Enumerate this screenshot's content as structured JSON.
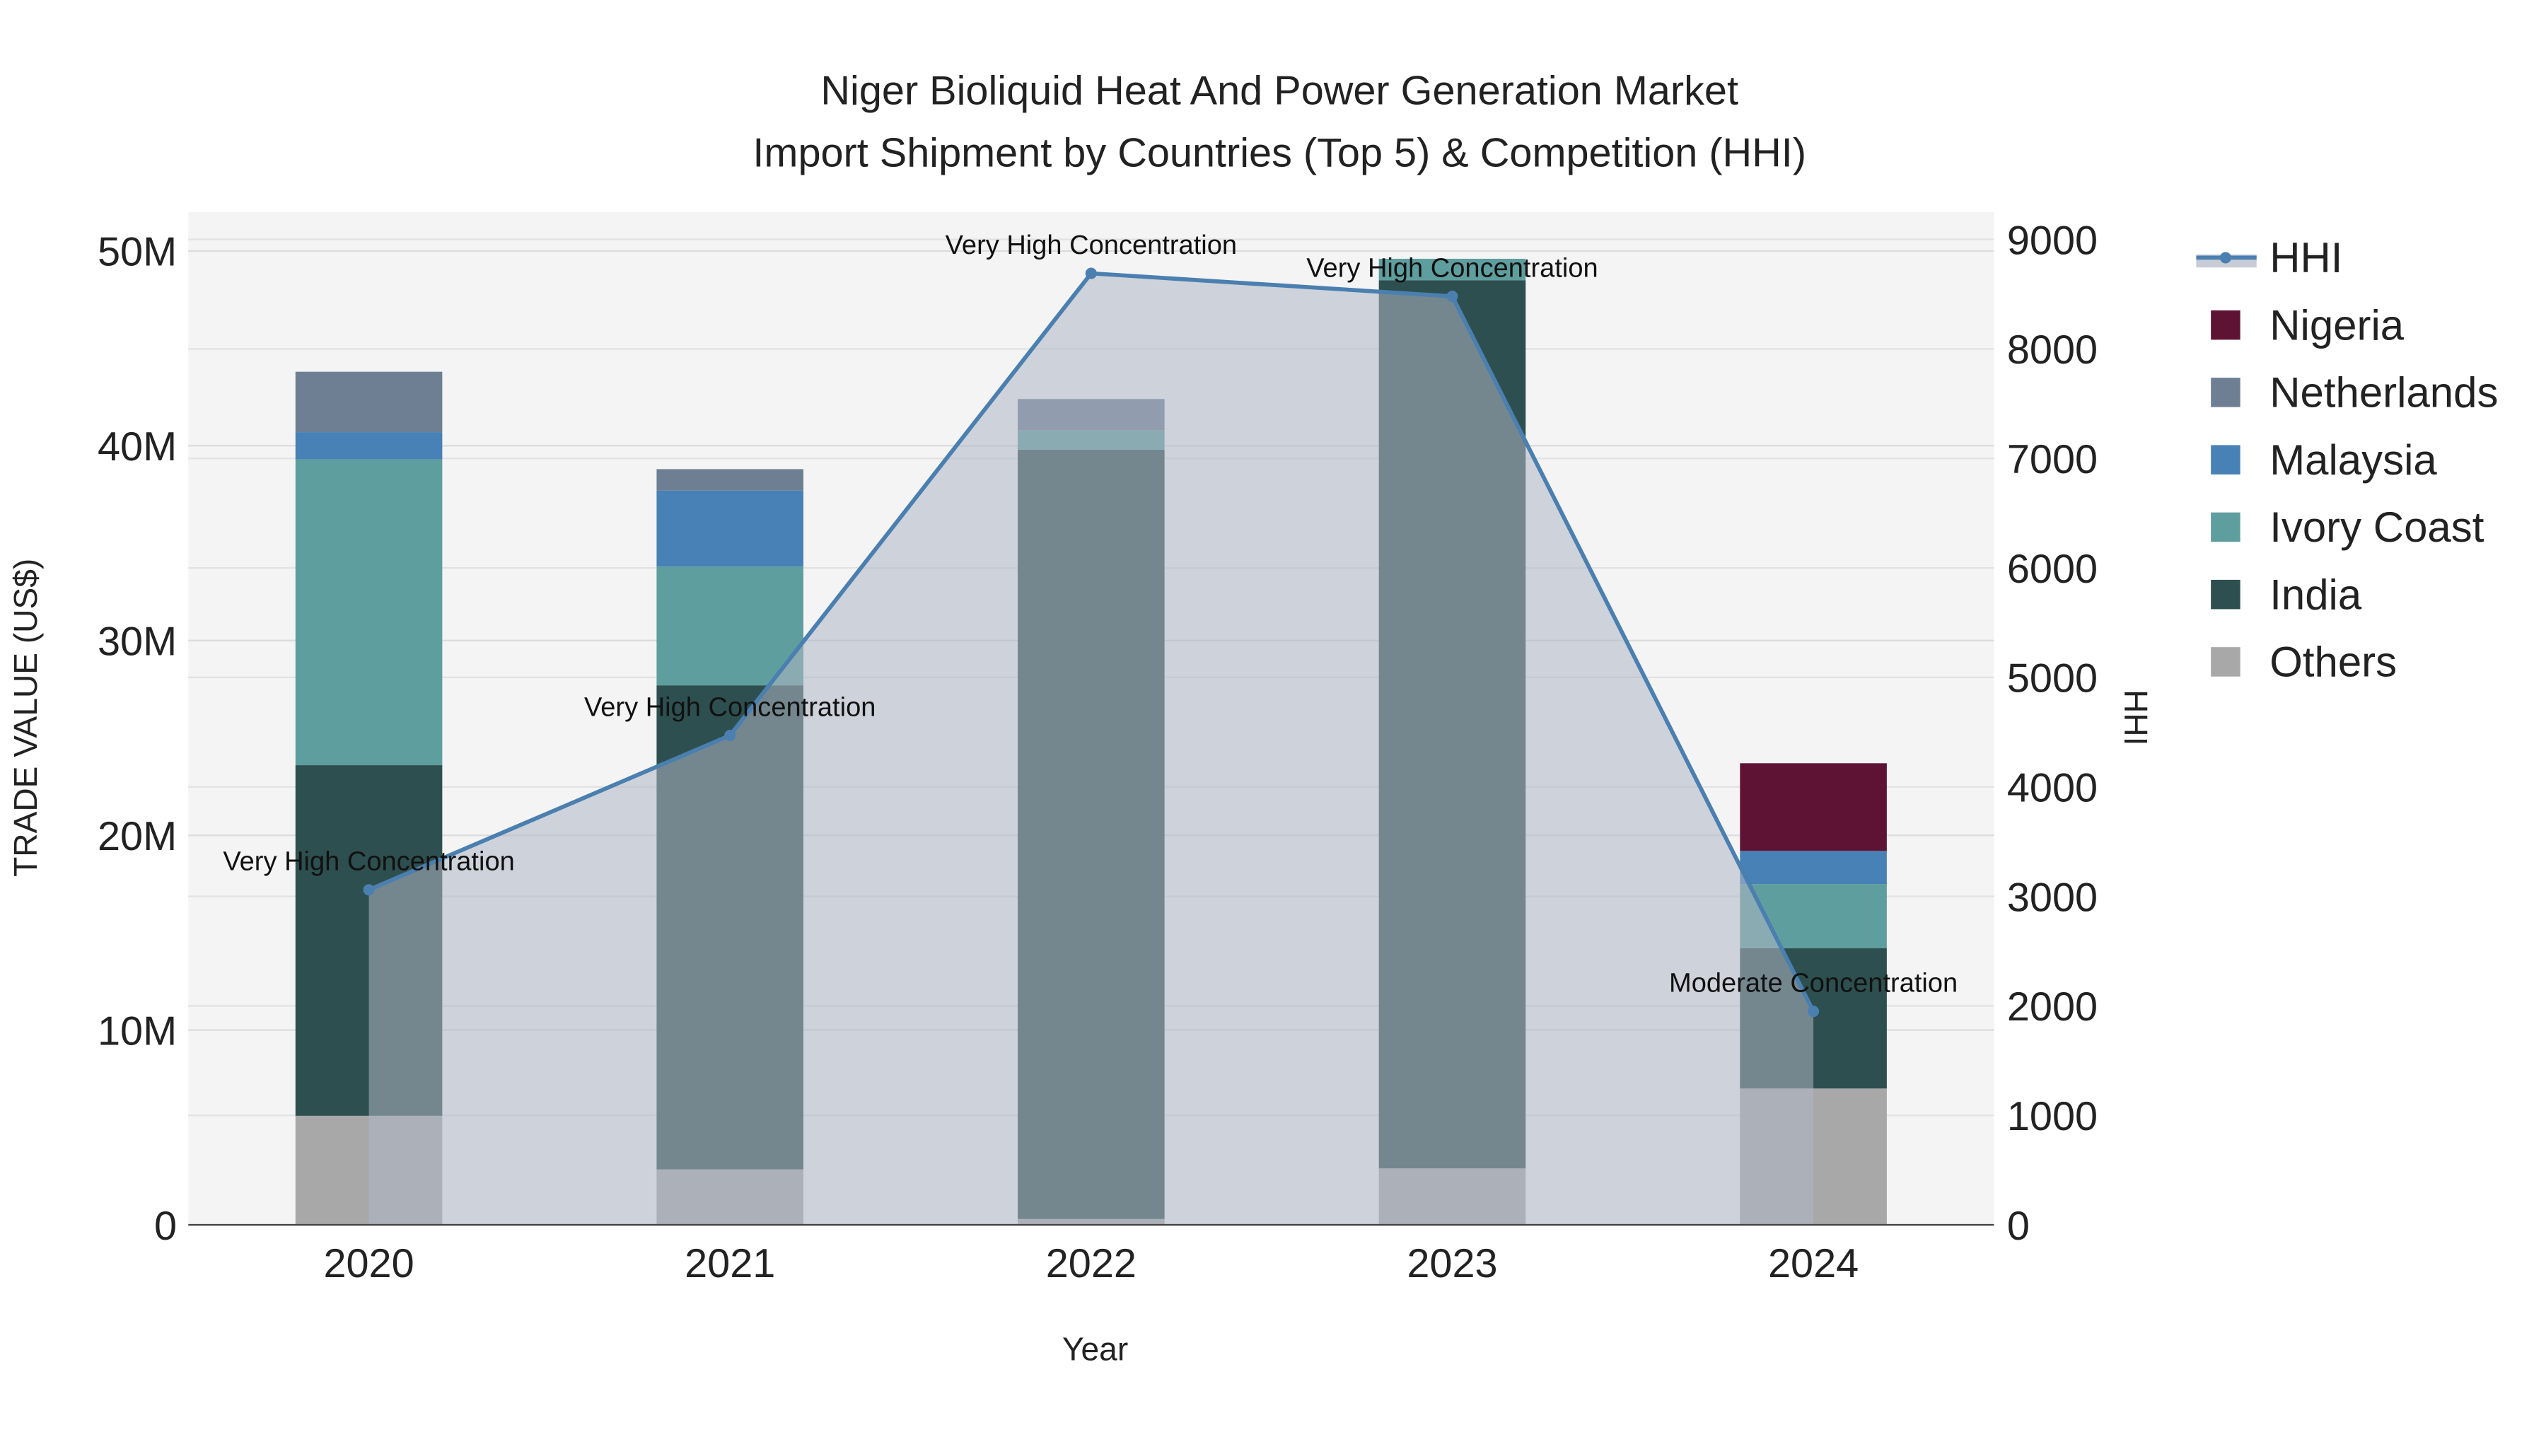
{
  "chart_data": {
    "type": "bar",
    "stacked": true,
    "title_line1": "Niger Bioliquid Heat And Power Generation Market",
    "title_line2": "Import Shipment by Countries (Top 5) & Competition (HHI)",
    "xlabel": "Year",
    "ylabel": "TRADE VALUE (US$)",
    "y2label": "HHI",
    "categories": [
      "2020",
      "2021",
      "2022",
      "2023",
      "2024"
    ],
    "ylim": [
      0,
      52000000
    ],
    "y_ticks": [
      0,
      10000000,
      20000000,
      30000000,
      40000000,
      50000000
    ],
    "y_tick_labels": [
      "0",
      "10M",
      "20M",
      "30M",
      "40M",
      "50M"
    ],
    "y2lim": [
      0,
      9250
    ],
    "y2_ticks": [
      0,
      1000,
      2000,
      3000,
      4000,
      5000,
      6000,
      7000,
      8000,
      9000
    ],
    "y2_tick_labels": [
      "0",
      "1000",
      "2000",
      "3000",
      "4000",
      "5000",
      "6000",
      "7000",
      "8000",
      "9000"
    ],
    "grid": true,
    "legend_position": "right",
    "series": [
      {
        "name": "Others",
        "color": "#a8a8a8",
        "values": [
          5600000,
          2850000,
          300000,
          2900000,
          7000000
        ]
      },
      {
        "name": "India",
        "color": "#2e4f4f",
        "values": [
          18000000,
          24850000,
          39500000,
          45600000,
          7200000
        ]
      },
      {
        "name": "Ivory Coast",
        "color": "#5f9e9e",
        "values": [
          15700000,
          6100000,
          1000000,
          1100000,
          3300000
        ]
      },
      {
        "name": "Malaysia",
        "color": "#4781b5",
        "values": [
          1400000,
          3900000,
          0,
          0,
          1700000
        ]
      },
      {
        "name": "Netherlands",
        "color": "#6e7f93",
        "values": [
          3100000,
          1100000,
          1600000,
          0,
          0
        ]
      },
      {
        "name": "Nigeria",
        "color": "#5f1334",
        "values": [
          0,
          0,
          0,
          0,
          4500000
        ]
      }
    ],
    "hhi": {
      "name": "HHI",
      "color": "#4a7fb0",
      "values": [
        3060,
        4470,
        8690,
        8480,
        1950
      ],
      "annotations": [
        "Very High Concentration",
        "Very High Concentration",
        "Very High Concentration",
        "Very High Concentration",
        "Moderate Concentration"
      ]
    },
    "legend": [
      "HHI",
      "Nigeria",
      "Netherlands",
      "Malaysia",
      "Ivory Coast",
      "India",
      "Others"
    ]
  }
}
